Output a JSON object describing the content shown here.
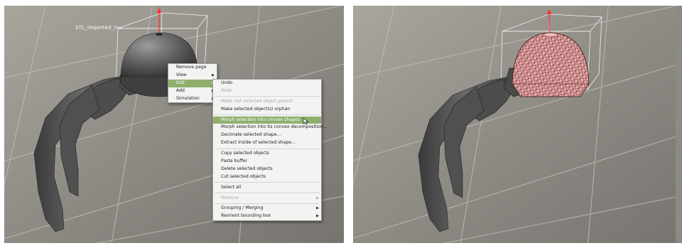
{
  "left_panel": {
    "object_label": "STL_Imported_inv"
  },
  "popup_menu": {
    "items": [
      {
        "label": "Remove page",
        "submenu": false
      },
      {
        "label": "View",
        "submenu": true
      },
      {
        "label": "Edit",
        "submenu": true,
        "highlighted": true
      },
      {
        "label": "Add",
        "submenu": true
      },
      {
        "label": "Simulation",
        "submenu": true
      }
    ]
  },
  "edit_submenu": {
    "items": [
      {
        "label": "Undo"
      },
      {
        "label": "Redo",
        "disabled": true
      },
      {
        "separator": true
      },
      {
        "label": "Make last selected object parent",
        "disabled": true
      },
      {
        "label": "Make selected object(s) orphan"
      },
      {
        "separator": true
      },
      {
        "label": "Morph selection into convex shapes",
        "highlighted": true
      },
      {
        "label": "Morph selection into its convex decomposition..."
      },
      {
        "label": "Decimate selected shape..."
      },
      {
        "label": "Extract inside of selected shape..."
      },
      {
        "separator": true
      },
      {
        "label": "Copy selected objects"
      },
      {
        "label": "Paste buffer"
      },
      {
        "label": "Delete selected objects"
      },
      {
        "label": "Cut selected objects"
      },
      {
        "separator": true
      },
      {
        "label": "Select all"
      },
      {
        "separator": true
      },
      {
        "label": "Remove",
        "disabled": true,
        "submenu": true
      },
      {
        "separator": true
      },
      {
        "label": "Grouping / Merging",
        "submenu": true
      },
      {
        "label": "Reorient bounding box",
        "submenu": true
      }
    ]
  },
  "icons": {
    "submenu_arrow": "triangle-right-icon",
    "cursor": "mouse-pointer-icon"
  },
  "colors": {
    "menu_highlight": "#8fb06d",
    "axis_red": "#ff3030",
    "convex_hull_pink": "#e9a8a8"
  }
}
